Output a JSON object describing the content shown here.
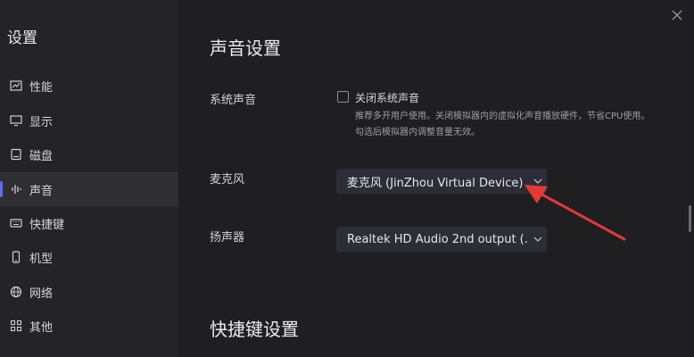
{
  "sidebar": {
    "title": "设置",
    "items": [
      {
        "label": "性能",
        "icon": "chart-icon"
      },
      {
        "label": "显示",
        "icon": "monitor-icon"
      },
      {
        "label": "磁盘",
        "icon": "disk-icon"
      },
      {
        "label": "声音",
        "icon": "sound-wave-icon",
        "active": true
      },
      {
        "label": "快捷键",
        "icon": "keyboard-icon"
      },
      {
        "label": "机型",
        "icon": "phone-icon"
      },
      {
        "label": "网络",
        "icon": "globe-icon"
      },
      {
        "label": "其他",
        "icon": "grid-icon"
      }
    ]
  },
  "main": {
    "sound_section_title": "声音设置",
    "system_sound": {
      "label": "系统声音",
      "checkbox_label": "关闭系统声音",
      "checked": false,
      "hint": "推荐多开用户使用。关闭模拟器内的虚拟化声音播放硬件，节省CPU使用。勾选后模拟器内调整音量无效。"
    },
    "microphone": {
      "label": "麦克风",
      "value": "麦克风 (JinZhou Virtual Device)"
    },
    "speaker": {
      "label": "扬声器",
      "value": "Realtek HD Audio 2nd output (..."
    },
    "shortcut_section_title": "快捷键设置"
  },
  "colors": {
    "accent": "#5b6cff",
    "annotation_arrow": "#e53935"
  }
}
